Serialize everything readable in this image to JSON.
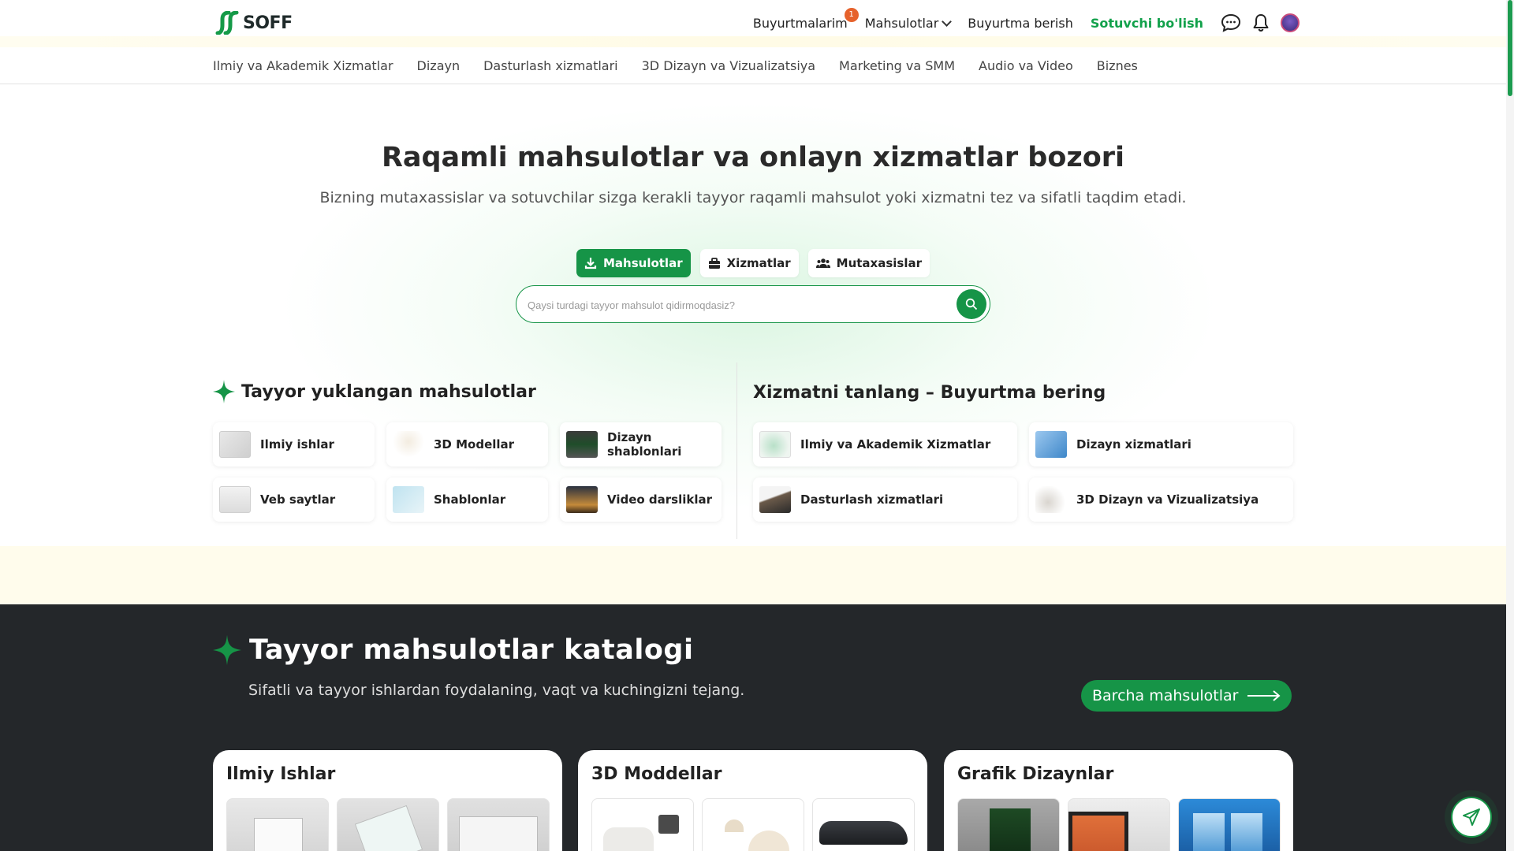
{
  "header": {
    "logo_text": "SOFF",
    "nav": {
      "orders": "Buyurtmalarim",
      "orders_badge": "1",
      "products": "Mahsulotlar",
      "place_order": "Buyurtma berish",
      "become_seller": "Sotuvchi bo'lish"
    },
    "icons": [
      "chat-icon",
      "bell-icon",
      "avatar"
    ]
  },
  "categories": [
    "Ilmiy va Akademik Xizmatlar",
    "Dizayn",
    "Dasturlash xizmatlari",
    "3D Dizayn va Vizualizatsiya",
    "Marketing va SMM",
    "Audio va Video",
    "Biznes"
  ],
  "hero": {
    "title": "Raqamli mahsulotlar va onlayn xizmatlar bozori",
    "subtitle": "Bizning mutaxassislar va sotuvchilar sizga kerakli tayyor raqamli mahsulot yoki xizmatni tez va sifatli taqdim etadi.",
    "tabs": [
      "Mahsulotlar",
      "Xizmatlar",
      "Mutaxasislar"
    ],
    "search_placeholder": "Qaysi turdagi tayyor mahsulot qidirmoqdasiz?"
  },
  "ready_products": {
    "title": "Tayyor yuklangan mahsulotlar",
    "items": [
      "Ilmiy ishlar",
      "3D Modellar",
      "Dizayn shablonlari",
      "Veb saytlar",
      "Shablonlar",
      "Video darsliklar"
    ]
  },
  "services": {
    "title": "Xizmatni tanlang – Buyurtma bering",
    "items": [
      "Ilmiy va Akademik Xizmatlar",
      "Dizayn xizmatlari",
      "Dasturlash xizmatlari",
      "3D Dizayn va Vizualizatsiya"
    ]
  },
  "catalog": {
    "title": "Tayyor mahsulotlar katalogi",
    "subtitle": "Sifatli va tayyor ishlardan foydalaning, vaqt va kuchingizni tejang.",
    "all_button": "Barcha mahsulotlar",
    "cards": [
      {
        "title": "Ilmiy Ishlar"
      },
      {
        "title": "3D Moddellar"
      },
      {
        "title": "Grafik Dizaynlar"
      }
    ]
  },
  "colors": {
    "brand_green": "#169447",
    "accent_green": "#12a14b",
    "dark_bg": "#24272a",
    "badge": "#e6622c"
  }
}
